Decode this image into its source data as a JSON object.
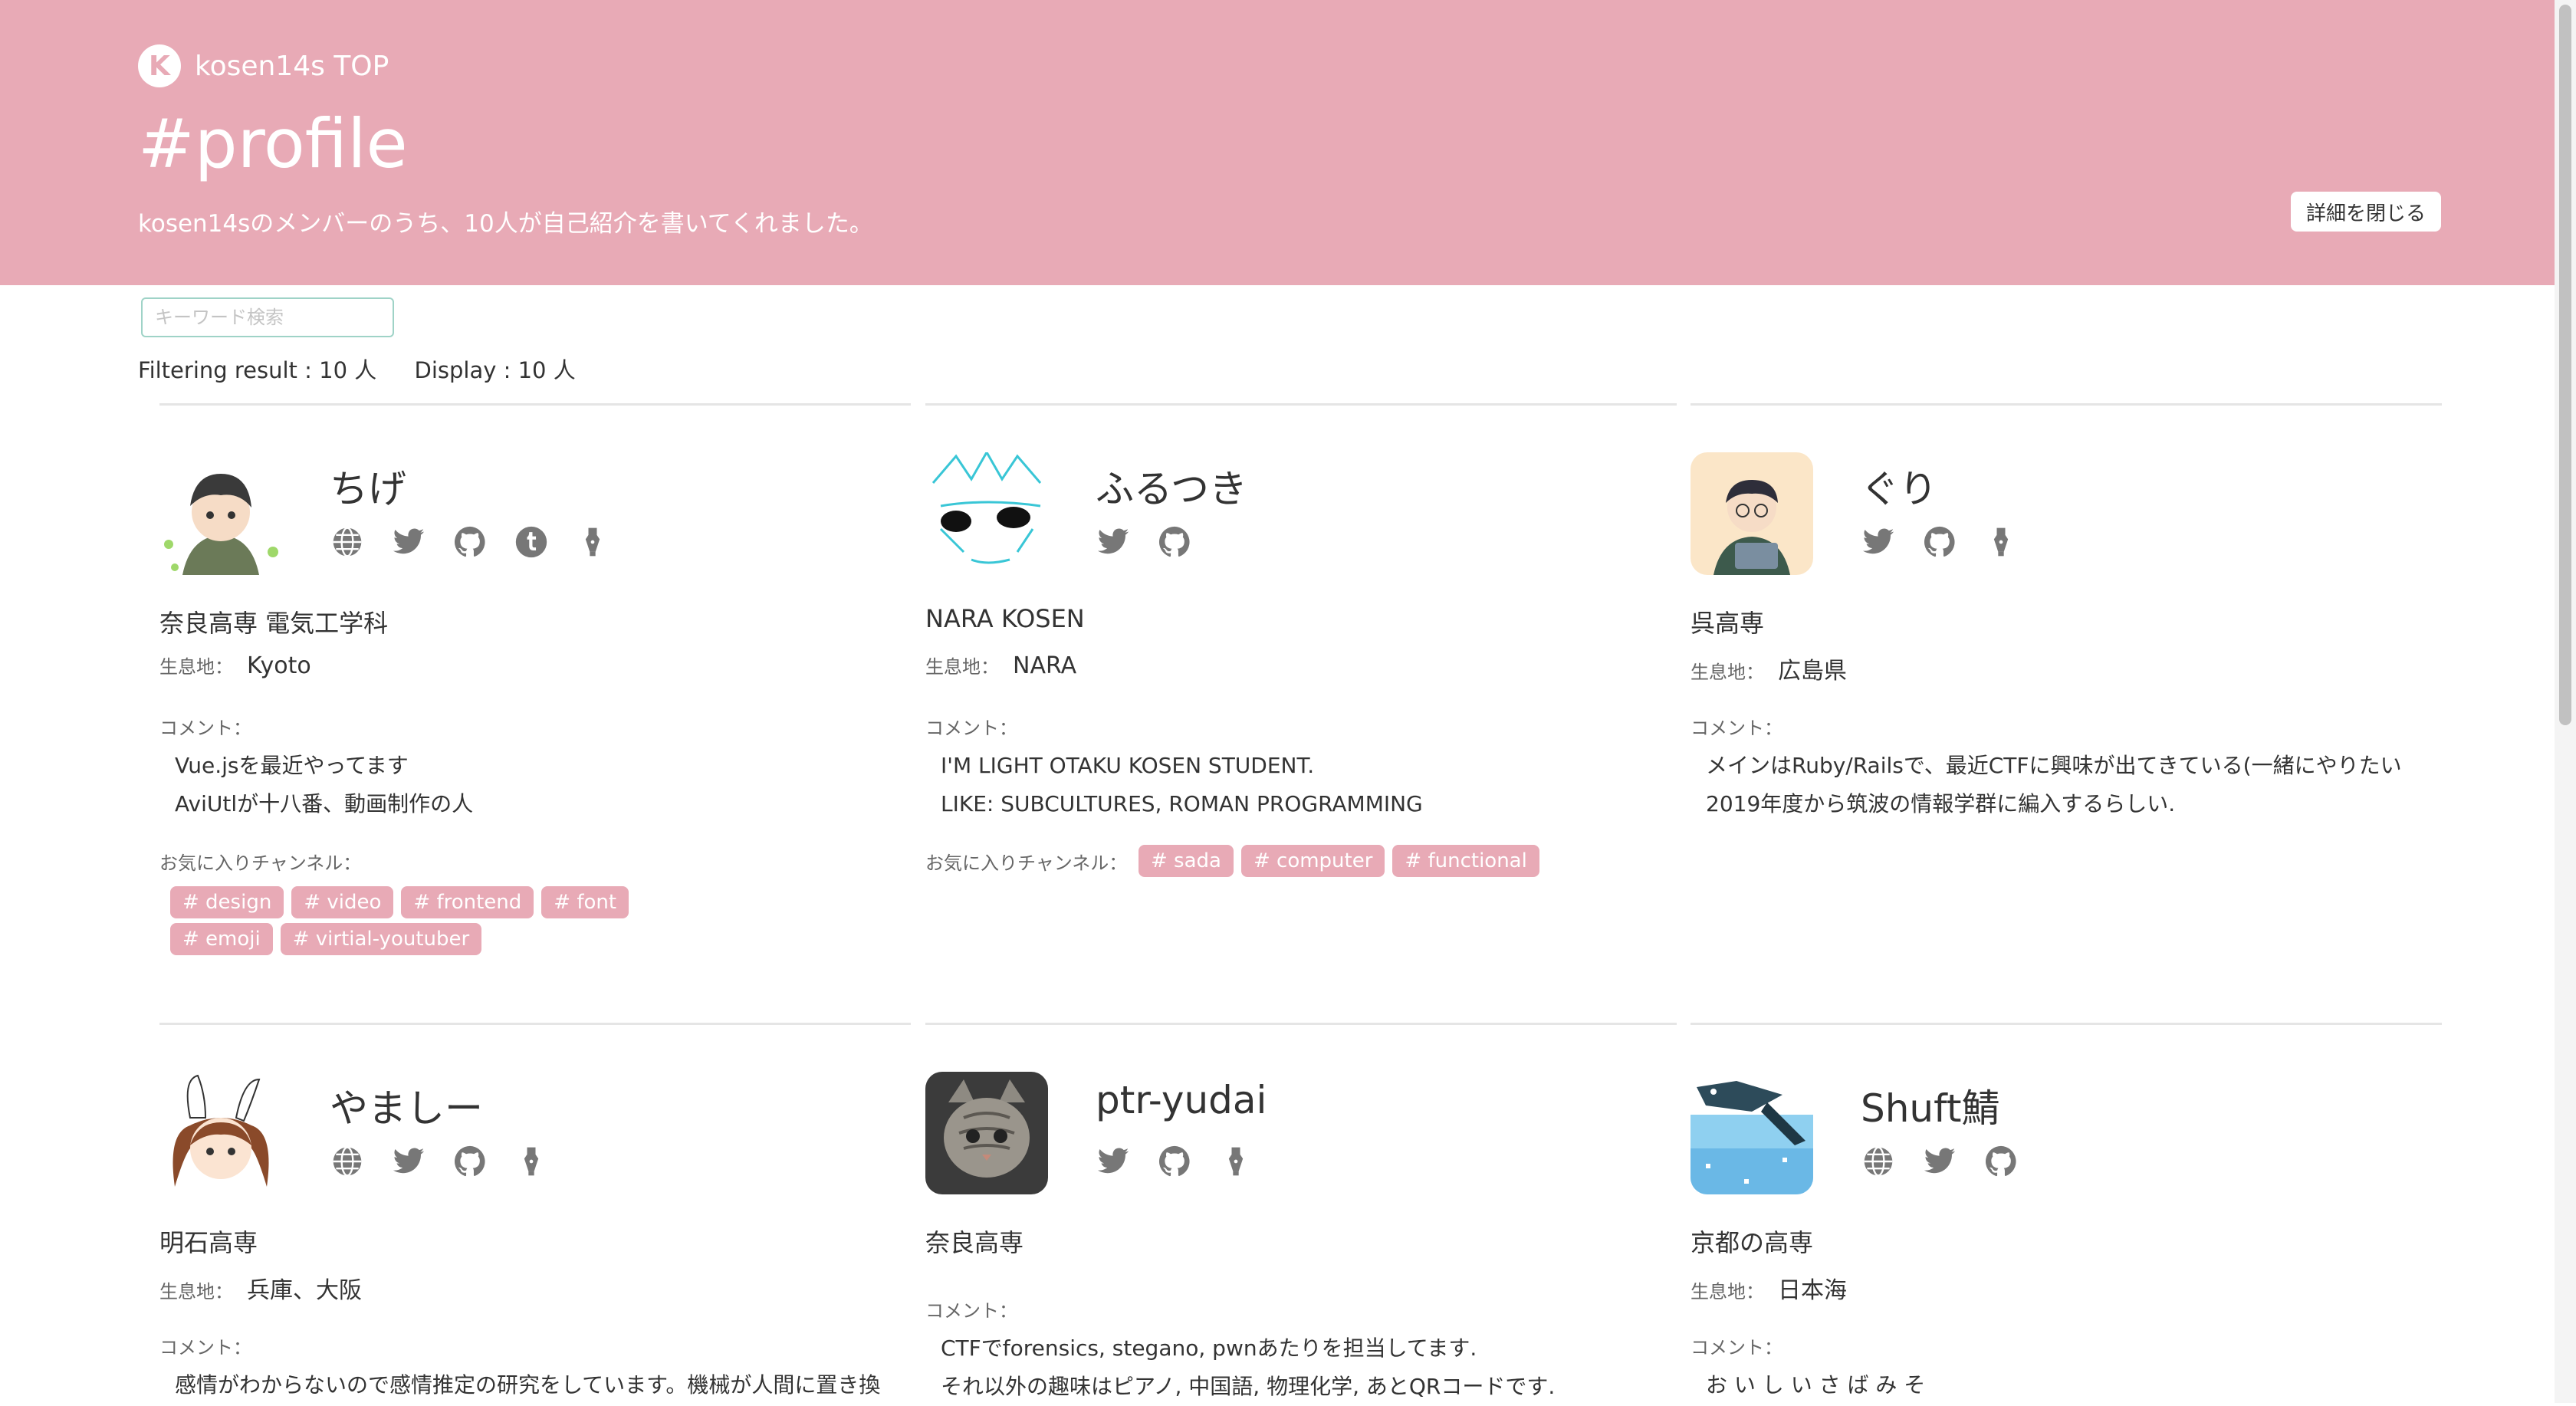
{
  "header": {
    "brand_logo": "K",
    "brand_text": "kosen14s TOP",
    "title": "#profile",
    "subtitle": "kosen14sのメンバーのうち、10人が自己紹介を書いてくれました。",
    "collapse_label": "詳細を閉じる",
    "bg_color": "#e8aab6"
  },
  "search": {
    "placeholder": "キーワード検索",
    "value": ""
  },
  "result": {
    "filtering": "Filtering result : 10 人",
    "display": "Display : 10 人"
  },
  "labels": {
    "habitat": "生息地：",
    "comment": "コメント：",
    "favorites": "お気に入りチャンネル："
  },
  "profiles": [
    {
      "name": "ちげ",
      "links": [
        "globe-icon",
        "twitter-icon",
        "github-icon",
        "tumblr-icon",
        "pen-icon"
      ],
      "school": "奈良高専 電気工学科",
      "habitat": "Kyoto",
      "comment": [
        "Vue.jsを最近やってます",
        "AviUtlが十八番、動画制作の人"
      ],
      "tags": [
        "# design",
        "# video",
        "# frontend",
        "# font",
        "# emoji",
        "# virtial-youtuber"
      ]
    },
    {
      "name": "ふるつき",
      "links": [
        "twitter-icon",
        "github-icon"
      ],
      "school": "NARA KOSEN",
      "habitat": "NARA",
      "comment": [
        "I'M LIGHT OTAKU KOSEN STUDENT.",
        "LIKE: SUBCULTURES, ROMAN PROGRAMMING"
      ],
      "tags": [
        "# sada",
        "# computer",
        "# functional"
      ]
    },
    {
      "name": "ぐり",
      "links": [
        "twitter-icon",
        "github-icon",
        "pen-icon"
      ],
      "school": "呉高専",
      "habitat": "広島県",
      "comment": [
        "メインはRuby/Railsで、最近CTFに興味が出てきている(一緒にやりたい",
        "2019年度から筑波の情報学群に編入するらしい."
      ],
      "tags": []
    },
    {
      "name": "やましー",
      "links": [
        "globe-icon",
        "twitter-icon",
        "github-icon",
        "pen-icon"
      ],
      "school": "明石高専",
      "habitat": "兵庫、大阪",
      "comment": [
        "感情がわからないので感情推定の研究をしています。機械が人間に置き換"
      ],
      "tags": []
    },
    {
      "name": "ptr-yudai",
      "links": [
        "twitter-icon",
        "github-icon",
        "pen-icon"
      ],
      "school": "奈良高専",
      "habitat": "",
      "comment": [
        "CTFでforensics, stegano, pwnあたりを担当してます.",
        "それ以外の趣味はピアノ, 中国語, 物理化学, あとQRコードです."
      ],
      "tags": []
    },
    {
      "name": "Shuft鯖",
      "links": [
        "globe-icon",
        "twitter-icon",
        "github-icon"
      ],
      "school": "京都の高専",
      "habitat": "日本海",
      "comment": [
        "お い し い さ ば み そ"
      ],
      "tags": []
    }
  ]
}
